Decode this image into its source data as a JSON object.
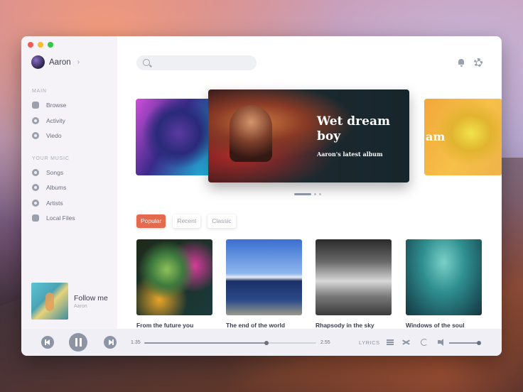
{
  "user": {
    "name": "Aaron"
  },
  "sidebar": {
    "main_label": "MAIN",
    "main_items": [
      {
        "label": "Browse",
        "icon": "browse-icon"
      },
      {
        "label": "Activity",
        "icon": "activity-icon"
      },
      {
        "label": "Viedo",
        "icon": "video-icon"
      }
    ],
    "music_label": "YOUR MUSIC",
    "music_items": [
      {
        "label": "Songs",
        "icon": "songs-icon"
      },
      {
        "label": "Albums",
        "icon": "albums-icon"
      },
      {
        "label": "Artists",
        "icon": "artists-icon"
      },
      {
        "label": "Local Files",
        "icon": "file-icon"
      }
    ],
    "now_following": {
      "title": "Follow me",
      "subtitle": "Aaron"
    }
  },
  "carousel": {
    "featured_title": "Wet dream boy",
    "featured_subtitle": "Aaron's latest album",
    "right_peek_text": "am",
    "slide_count": 3,
    "active_slide": 1
  },
  "tabs": [
    {
      "label": "Popular",
      "active": true
    },
    {
      "label": "Recent",
      "active": false
    },
    {
      "label": "Classic",
      "active": false
    }
  ],
  "albums": [
    {
      "title": "From the future you"
    },
    {
      "title": "The end of the world"
    },
    {
      "title": "Rhapsody in the sky"
    },
    {
      "title": "Windows of the soul"
    }
  ],
  "player": {
    "elapsed": "1.35",
    "duration": "2.55",
    "progress": 0.71,
    "lyrics_label": "LYRICS",
    "volume": 0.95
  },
  "colors": {
    "accent": "#e46a4f",
    "sidebar_bg": "#f4f1f8",
    "text_dark": "#3a3f4f",
    "text_muted": "#9aa0ad"
  }
}
